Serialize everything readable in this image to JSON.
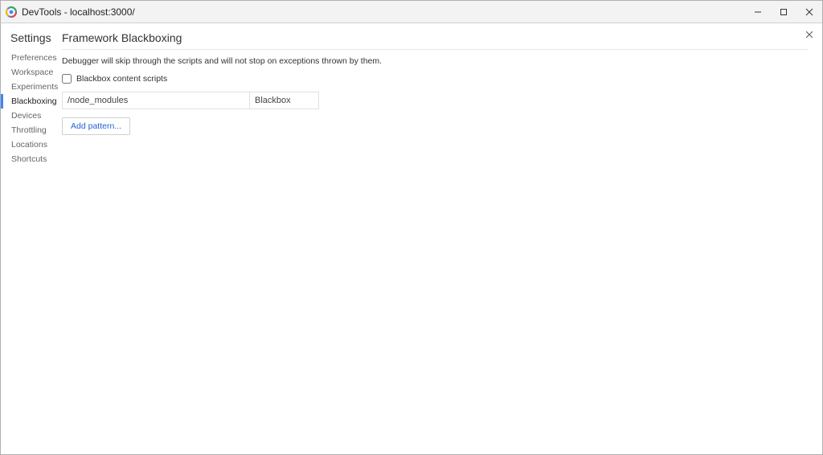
{
  "window": {
    "title": "DevTools - localhost:3000/"
  },
  "sidebar": {
    "title": "Settings",
    "items": [
      {
        "label": "Preferences",
        "active": false
      },
      {
        "label": "Workspace",
        "active": false
      },
      {
        "label": "Experiments",
        "active": false
      },
      {
        "label": "Blackboxing",
        "active": true
      },
      {
        "label": "Devices",
        "active": false
      },
      {
        "label": "Throttling",
        "active": false
      },
      {
        "label": "Locations",
        "active": false
      },
      {
        "label": "Shortcuts",
        "active": false
      }
    ]
  },
  "main": {
    "page_title": "Framework Blackboxing",
    "helptext": "Debugger will skip through the scripts and will not stop on exceptions thrown by them.",
    "blackbox_content_scripts_label": "Blackbox content scripts",
    "blackbox_content_scripts_checked": false,
    "patterns": [
      {
        "pattern": "/node_modules",
        "behavior": "Blackbox"
      }
    ],
    "add_pattern_label": "Add pattern..."
  }
}
